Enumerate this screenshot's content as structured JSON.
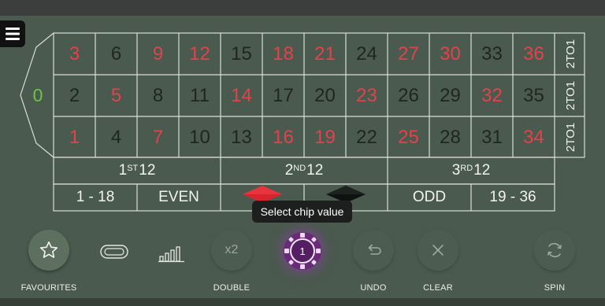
{
  "colors": {
    "felt": "#4b5a4e",
    "red": "#e1434b",
    "black_number": "#1f2521",
    "zero": "#6fc443",
    "chip": "#6a2a79"
  },
  "menu": {
    "icon": "hamburger-menu-icon"
  },
  "zero": "0",
  "numbers": [
    [
      "3",
      "6",
      "9",
      "12",
      "15",
      "18",
      "21",
      "24",
      "27",
      "30",
      "33",
      "36"
    ],
    [
      "2",
      "5",
      "8",
      "11",
      "14",
      "17",
      "20",
      "23",
      "26",
      "29",
      "32",
      "35"
    ],
    [
      "1",
      "4",
      "7",
      "10",
      "13",
      "16",
      "19",
      "22",
      "25",
      "28",
      "31",
      "34"
    ]
  ],
  "red_numbers": [
    "1",
    "3",
    "5",
    "7",
    "9",
    "12",
    "14",
    "16",
    "18",
    "19",
    "21",
    "23",
    "25",
    "27",
    "30",
    "32",
    "34",
    "36"
  ],
  "column_bets": [
    "2TO1",
    "2TO1",
    "2TO1"
  ],
  "dozens": [
    {
      "sup": "ST",
      "label": "1",
      "suffix": "12"
    },
    {
      "sup": "ND",
      "label": "2",
      "suffix": "12"
    },
    {
      "sup": "RD",
      "label": "3",
      "suffix": "12"
    }
  ],
  "outside_bets": {
    "low": "1 - 18",
    "even": "EVEN",
    "red_icon": "red-diamond-icon",
    "black_icon": "black-diamond-icon",
    "odd": "ODD",
    "high": "19 - 36"
  },
  "tooltip": "Select chip value",
  "controls": {
    "favourites": {
      "label": "FAVOURITES",
      "icon": "star-icon"
    },
    "racetrack": {
      "icon": "racetrack-icon"
    },
    "stats": {
      "icon": "bar-chart-icon"
    },
    "double": {
      "label": "DOUBLE",
      "icon_text": "x2"
    },
    "chip": {
      "value": "1"
    },
    "undo": {
      "label": "UNDO",
      "icon": "undo-icon"
    },
    "clear": {
      "label": "CLEAR",
      "icon": "close-icon"
    },
    "spin": {
      "label": "SPIN",
      "icon": "refresh-icon"
    }
  }
}
